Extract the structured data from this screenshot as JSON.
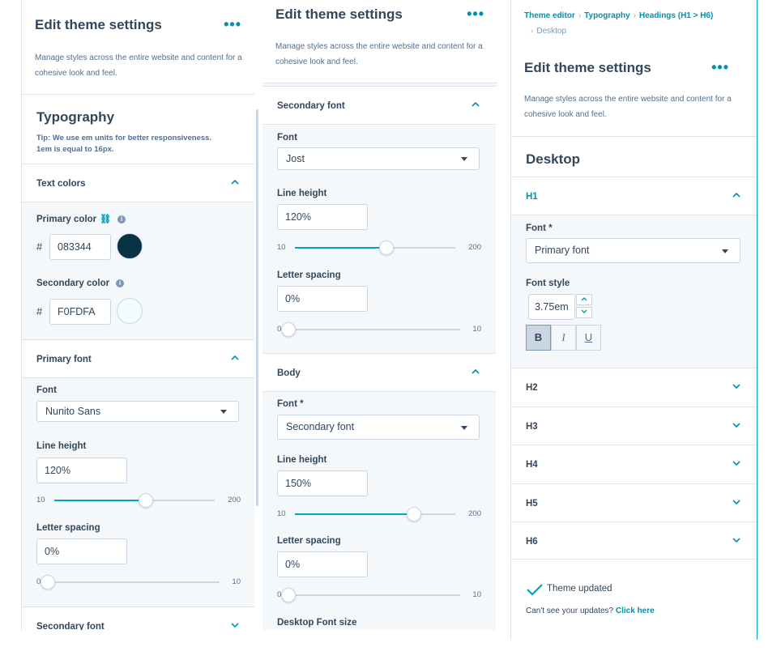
{
  "panel1": {
    "title": "Edit theme settings",
    "more": "•••",
    "description": "Manage styles across the entire website and content for a cohesive look and feel.",
    "section_title": "Typography",
    "tip_line1": "Tip: We use em units for better responsiveness.",
    "tip_line2": "1em is equal to 16px.",
    "text_colors_label": "Text colors",
    "primary_color_label": "Primary color",
    "primary_color_value": "083344",
    "primary_color_hex": "#083344",
    "secondary_color_label": "Secondary color",
    "secondary_color_value": "F0FDFA",
    "secondary_color_hex": "#F0FDFA",
    "hash": "#",
    "primary_font_label": "Primary font",
    "font_label": "Font",
    "font_value": "Nunito Sans",
    "line_height_label": "Line height",
    "line_height_value": "120%",
    "line_height_min": "10",
    "line_height_max": "200",
    "line_height_level": 0.57,
    "letter_spacing_label": "Letter spacing",
    "letter_spacing_value": "0%",
    "letter_spacing_min": "0",
    "letter_spacing_max": "10",
    "letter_spacing_level": 0,
    "secondary_font_label": "Secondary font"
  },
  "panel2": {
    "title": "Edit theme settings",
    "more": "•••",
    "description": "Manage styles across the entire website and content for a cohesive look and feel.",
    "secondary_font_label": "Secondary font",
    "font_label": "Font",
    "font_value": "Jost",
    "line_height_label": "Line height",
    "line_height_value": "120%",
    "line_height_min": "10",
    "line_height_max": "200",
    "line_height_level": 0.57,
    "letter_spacing_label": "Letter spacing",
    "letter_spacing_value": "0%",
    "letter_spacing_min": "0",
    "letter_spacing_max": "10",
    "letter_spacing_level": 0,
    "body_label": "Body",
    "body_font_label": "Font *",
    "body_font_value": "Secondary font",
    "body_line_height_label": "Line height",
    "body_line_height_value": "150%",
    "body_line_height_min": "10",
    "body_line_height_max": "200",
    "body_line_height_level": 0.74,
    "body_letter_spacing_label": "Letter spacing",
    "body_letter_spacing_value": "0%",
    "body_letter_spacing_min": "0",
    "body_letter_spacing_max": "10",
    "body_letter_spacing_level": 0,
    "desktop_font_size_label": "Desktop Font size"
  },
  "panel3": {
    "crumb1": "Theme editor",
    "crumb2": "Typography",
    "crumb3": "Headings (H1 > H6)",
    "crumb4": "Desktop",
    "title": "Edit theme settings",
    "more": "•••",
    "description": "Manage styles across the entire website and content for a cohesive look and feel.",
    "section_title": "Desktop",
    "h1_label": "H1",
    "font_label": "Font *",
    "font_value": "Primary font",
    "font_style_label": "Font style",
    "font_size_value": "3.75em",
    "bold_label": "B",
    "italic_label": "I",
    "underline_label": "U",
    "headings": [
      "H2",
      "H3",
      "H4",
      "H5",
      "H6"
    ],
    "toast": "Theme updated",
    "note_text": "Can't see your updates?",
    "note_link": "Click here"
  },
  "colors": {
    "accent": "#00a4bd",
    "link": "#0091ae",
    "text": "#33475b"
  }
}
